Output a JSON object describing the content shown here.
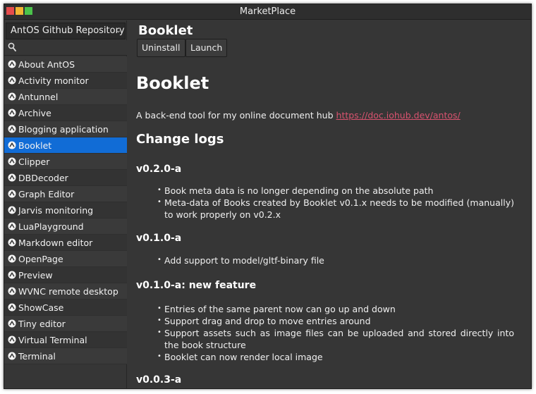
{
  "window": {
    "title": "MarketPlace",
    "buttons": {
      "close_color": "#e64c4c",
      "minimize_color": "#f2b533",
      "maximize_color": "#4bc34b"
    }
  },
  "sidebar": {
    "repository": "AntOS Github Repository",
    "search": {
      "value": "",
      "placeholder": ""
    },
    "selected_index": 5,
    "items": [
      "About AntOS",
      "Activity monitor",
      "Antunnel",
      "Archive",
      "Blogging application",
      "Booklet",
      "Clipper",
      "DBDecoder",
      "Graph Editor",
      "Jarvis monitoring",
      "LuaPlayground",
      "Markdown editor",
      "OpenPage",
      "Preview",
      "WVNC remote desktop",
      "ShowCase",
      "Tiny editor",
      "Virtual Terminal",
      "Terminal"
    ]
  },
  "detail": {
    "name": "Booklet",
    "uninstall_label": "Uninstall",
    "launch_label": "Launch",
    "readme": {
      "heading": "Booklet",
      "description": "A back-end tool for my online document hub",
      "link": "https://doc.iohub.dev/antos/",
      "changelog_heading": "Change logs",
      "sections": [
        {
          "version": "v0.2.0-a",
          "items": [
            "Book meta data is no longer depending on the absolute path",
            "Meta-data of Books created by Booklet v0.1.x needs to be modified (manually) to work properly on v0.2.x"
          ]
        },
        {
          "version": "v0.1.0-a",
          "items": [
            "Add support to model/gltf-binary file"
          ]
        },
        {
          "version": "v0.1.0-a: new feature",
          "items": [
            "Entries of the same parent now can go up and down",
            "Support drag and drop to move entries around",
            "Support assets such as image files can be uploaded and stored directly into the book structure",
            "Booklet can now render local image"
          ]
        },
        {
          "version": "v0.0.3-a",
          "items": []
        }
      ]
    }
  },
  "colors": {
    "accent": "#116cd6",
    "link": "#d9536f",
    "background": "#363636"
  }
}
